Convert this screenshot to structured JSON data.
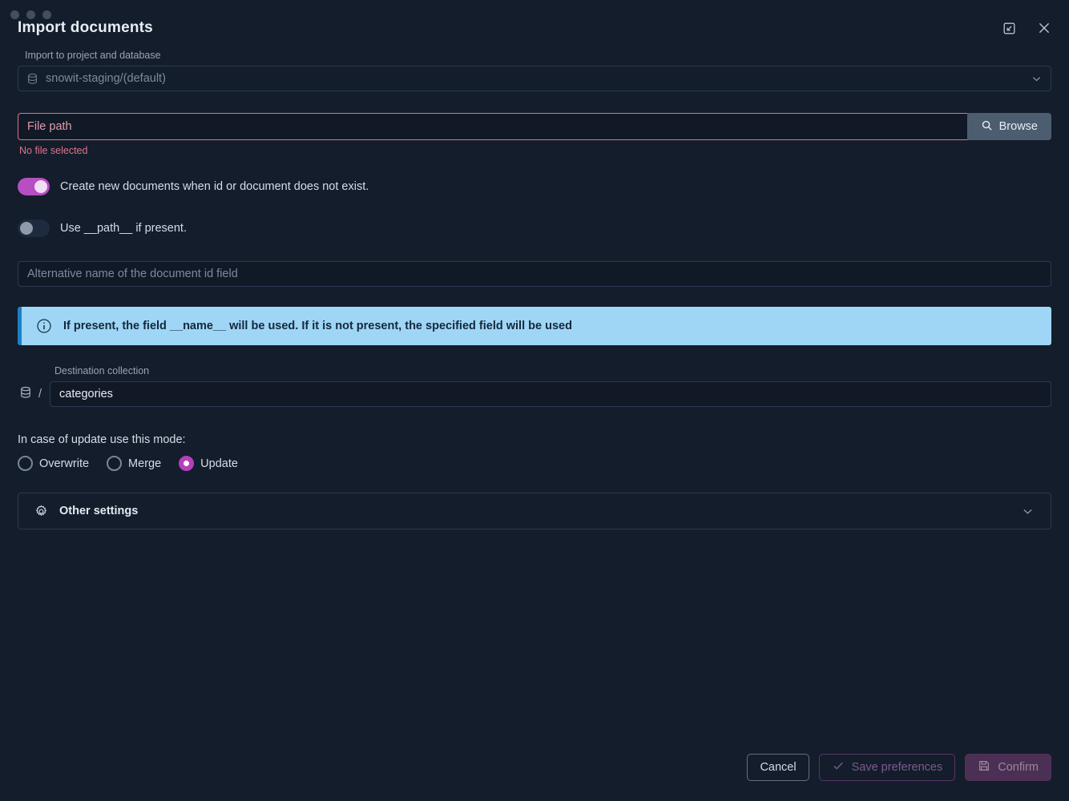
{
  "window": {
    "title": "Import documents",
    "restore_icon": "restore-window-icon",
    "close_icon": "close-icon"
  },
  "project_select": {
    "label": "Import to project and database",
    "value": "snowit-staging/(default)",
    "icon": "database-icon",
    "chevron": "chevron-down-icon"
  },
  "file_path": {
    "placeholder": "File path",
    "value": "",
    "browse_label": "Browse",
    "browse_icon": "search-icon",
    "error": "No file selected",
    "error_color": "#e0748c"
  },
  "toggles": [
    {
      "label": "Create new documents when id or document does not exist.",
      "state": "on",
      "on_color": "#b74ec2"
    },
    {
      "label": "Use __path__ if present.",
      "state": "off",
      "off_color": "#1e2a3d"
    }
  ],
  "alt_id_field": {
    "placeholder": "Alternative name of the document id field",
    "value": ""
  },
  "info_banner": {
    "icon": "info-circle-icon",
    "message": "If present, the field __name__ will be used. If it is not present, the specified field will be used",
    "background": "#9fd6f5",
    "accent": "#1c7fc4"
  },
  "destination": {
    "label": "Destination collection",
    "icon": "database-icon",
    "separator": "/",
    "value": "categories"
  },
  "update_mode": {
    "title": "In case of update use this mode:",
    "options": [
      {
        "label": "Overwrite",
        "selected": false
      },
      {
        "label": "Merge",
        "selected": false
      },
      {
        "label": "Update",
        "selected": true
      }
    ],
    "selected_color": "#b63fbd"
  },
  "other_settings": {
    "label": "Other settings",
    "icon": "gear-icon",
    "chevron": "chevron-down-icon",
    "expanded": false
  },
  "footer": {
    "cancel_label": "Cancel",
    "save_prefs_label": "Save preferences",
    "save_prefs_icon": "check-icon",
    "confirm_label": "Confirm",
    "confirm_icon": "save-disk-icon"
  }
}
